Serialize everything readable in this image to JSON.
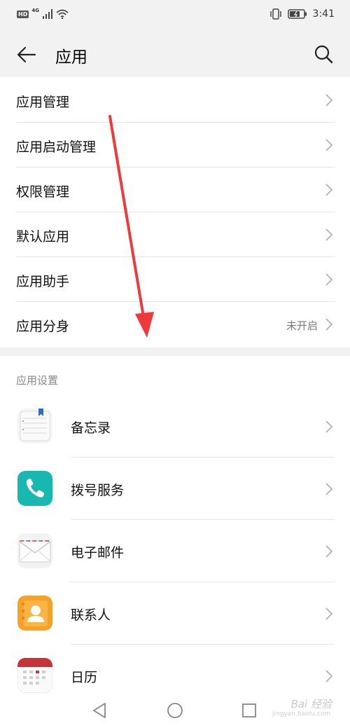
{
  "status_bar": {
    "hd": "HD",
    "network": "4G",
    "time": "3:41"
  },
  "header": {
    "title": "应用",
    "back_icon": "back-arrow-icon",
    "search_icon": "search-icon"
  },
  "settings": [
    {
      "label": "应用管理"
    },
    {
      "label": "应用启动管理"
    },
    {
      "label": "权限管理"
    },
    {
      "label": "默认应用"
    },
    {
      "label": "应用助手"
    },
    {
      "label": "应用分身",
      "value": "未开启"
    }
  ],
  "app_section": {
    "title": "应用设置",
    "apps": [
      {
        "label": "备忘录",
        "icon": "notepad-icon"
      },
      {
        "label": "拨号服务",
        "icon": "phone-icon"
      },
      {
        "label": "电子邮件",
        "icon": "email-icon"
      },
      {
        "label": "联系人",
        "icon": "contacts-icon"
      },
      {
        "label": "日历",
        "icon": "calendar-icon"
      }
    ]
  },
  "watermark": {
    "text": "Bai 经验",
    "sub": "jingyan.baidu.com"
  },
  "colors": {
    "header_bg": "#f2f2f2",
    "annotation_arrow": "#ee3a3a",
    "phone_icon": "#16b8b0",
    "contacts_icon": "#f5a22a",
    "calendar_icon": "#c8323a"
  }
}
